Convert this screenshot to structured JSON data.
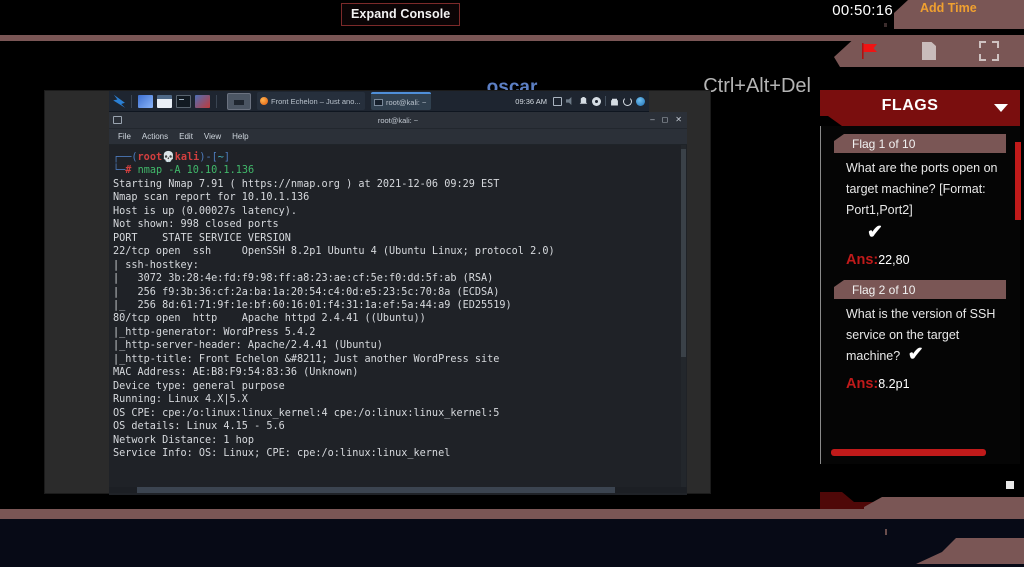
{
  "topbar": {
    "expand_console_label": "Expand Console",
    "timer": "00:50:16",
    "add_time_label": "Add Time"
  },
  "controlbar": {
    "machine_name": "oscar",
    "ctrl_alt_del_label": "Ctrl+Alt+Del",
    "icons": [
      "flag-icon",
      "document-icon",
      "fullscreen-icon"
    ]
  },
  "desktop": {
    "panel": {
      "logo": "kali-dragon-icon",
      "launchers": [
        "terminal-launcher-icon",
        "files-launcher-icon",
        "terminal2-launcher-icon",
        "burp-launcher-icon"
      ],
      "windows": [
        {
          "icon": "firefox-icon",
          "title": "Front Echelon – Just ano..."
        },
        {
          "icon": "terminal-icon",
          "title": "root@kali: ~"
        }
      ],
      "clock": "09:36 AM",
      "tray_icons": [
        "display-icon",
        "volume-icon",
        "notification-bell-icon",
        "settings-gear-icon",
        "lock-icon",
        "power-icon",
        "network-icon"
      ]
    },
    "terminal": {
      "title": "root@kali: ~",
      "window_controls": [
        "minimize",
        "maximize",
        "close"
      ],
      "menu": [
        "File",
        "Actions",
        "Edit",
        "View",
        "Help"
      ],
      "prompt_user": "root",
      "prompt_host": "kali",
      "prompt_path": "~",
      "command": "nmap -A 10.10.1.136",
      "output_lines": [
        "Starting Nmap 7.91 ( https://nmap.org ) at 2021-12-06 09:29 EST",
        "Nmap scan report for 10.10.1.136",
        "Host is up (0.00027s latency).",
        "Not shown: 998 closed ports",
        "PORT    STATE SERVICE VERSION",
        "22/tcp open  ssh     OpenSSH 8.2p1 Ubuntu 4 (Ubuntu Linux; protocol 2.0)",
        "| ssh-hostkey:",
        "|   3072 3b:28:4e:fd:f9:98:ff:a8:23:ae:cf:5e:f0:dd:5f:ab (RSA)",
        "|   256 f9:3b:36:cf:2a:ba:1a:20:54:c4:0d:e5:23:5c:70:8a (ECDSA)",
        "|_  256 8d:61:71:9f:1e:bf:60:16:01:f4:31:1a:ef:5a:44:a9 (ED25519)",
        "80/tcp open  http    Apache httpd 2.4.41 ((Ubuntu))",
        "|_http-generator: WordPress 5.4.2",
        "|_http-server-header: Apache/2.4.41 (Ubuntu)",
        "|_http-title: Front Echelon &#8211; Just another WordPress site",
        "MAC Address: AE:B8:F9:54:83:36 (Unknown)",
        "Device type: general purpose",
        "Running: Linux 4.X|5.X",
        "OS CPE: cpe:/o:linux:linux_kernel:4 cpe:/o:linux:linux_kernel:5",
        "OS details: Linux 4.15 - 5.6",
        "Network Distance: 1 hop",
        "Service Info: OS: Linux; CPE: cpe:/o:linux:linux_kernel"
      ]
    }
  },
  "flags": {
    "title": "FLAGS",
    "caret": "chevron-down-icon",
    "items": [
      {
        "chip": "Flag 1 of 10",
        "question": "What are the ports open on target machine? [Format: Port1,Port2]",
        "solved_mark": "✔",
        "answer_label": "Ans:",
        "answer": "22,80"
      },
      {
        "chip": "Flag 2 of 10",
        "question": "What is the version of SSH service on the target machine?",
        "solved_mark": "✔",
        "answer_label": "Ans:",
        "answer": "8.2p1"
      }
    ]
  },
  "colors": {
    "accent_red": "#c01a1a",
    "header_red": "#7a0e0e",
    "chrome_mauve": "#7a5655",
    "add_time_orange": "#f0a030",
    "machine_name_blue": "#5c7fc4"
  }
}
